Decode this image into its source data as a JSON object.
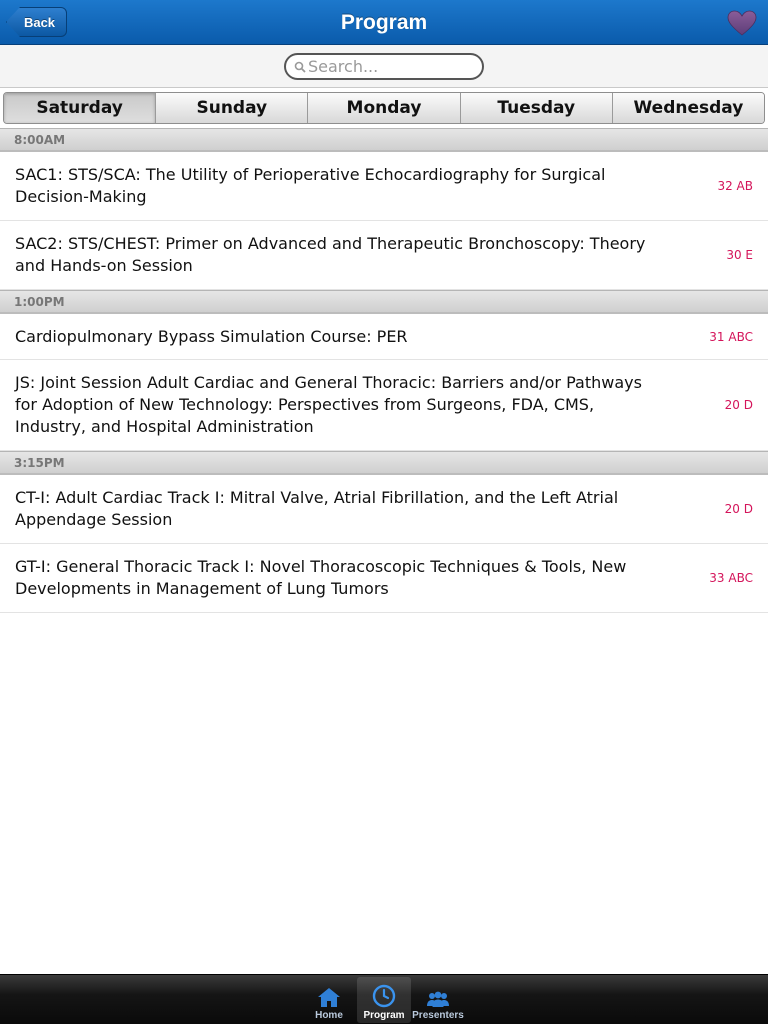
{
  "nav": {
    "back_label": "Back",
    "title": "Program",
    "favorite_icon": "heart-icon"
  },
  "search": {
    "placeholder": "Search..."
  },
  "days": [
    {
      "label": "Saturday",
      "selected": true
    },
    {
      "label": "Sunday",
      "selected": false
    },
    {
      "label": "Monday",
      "selected": false
    },
    {
      "label": "Tuesday",
      "selected": false
    },
    {
      "label": "Wednesday",
      "selected": false
    }
  ],
  "sections": [
    {
      "time": "8:00AM",
      "sessions": [
        {
          "title": "SAC1: STS/SCA: The Utility of Perioperative Echocardiography for Surgical Decision-Making",
          "room": "32 AB"
        },
        {
          "title": "SAC2: STS/CHEST: Primer on Advanced and Therapeutic Bronchoscopy: Theory and Hands-on Session",
          "room": "30 E"
        }
      ]
    },
    {
      "time": "1:00PM",
      "sessions": [
        {
          "title": "Cardiopulmonary Bypass Simulation Course: PER",
          "room": "31 ABC"
        },
        {
          "title": "JS: Joint Session Adult Cardiac and General Thoracic: Barriers and/or Pathways for Adoption of New Technology: Perspectives from Surgeons, FDA, CMS, Industry, and Hospital Administration",
          "room": "20 D"
        }
      ]
    },
    {
      "time": "3:15PM",
      "sessions": [
        {
          "title": "CT-I: Adult Cardiac Track I: Mitral Valve, Atrial Fibrillation, and the Left Atrial Appendage Session",
          "room": "20 D"
        },
        {
          "title": "GT-I: General Thoracic Track I: Novel Thoracoscopic Techniques & Tools, New Developments in Management of Lung Tumors",
          "room": "33 ABC"
        }
      ]
    }
  ],
  "tabbar": [
    {
      "label": "Home",
      "icon": "home-icon",
      "active": false
    },
    {
      "label": "Program",
      "icon": "clock-icon",
      "active": true
    },
    {
      "label": "Presenters",
      "icon": "people-icon",
      "active": false
    }
  ],
  "colors": {
    "nav_blue": "#0a5bab",
    "room_text": "#d4145a",
    "section_text": "#777777"
  }
}
